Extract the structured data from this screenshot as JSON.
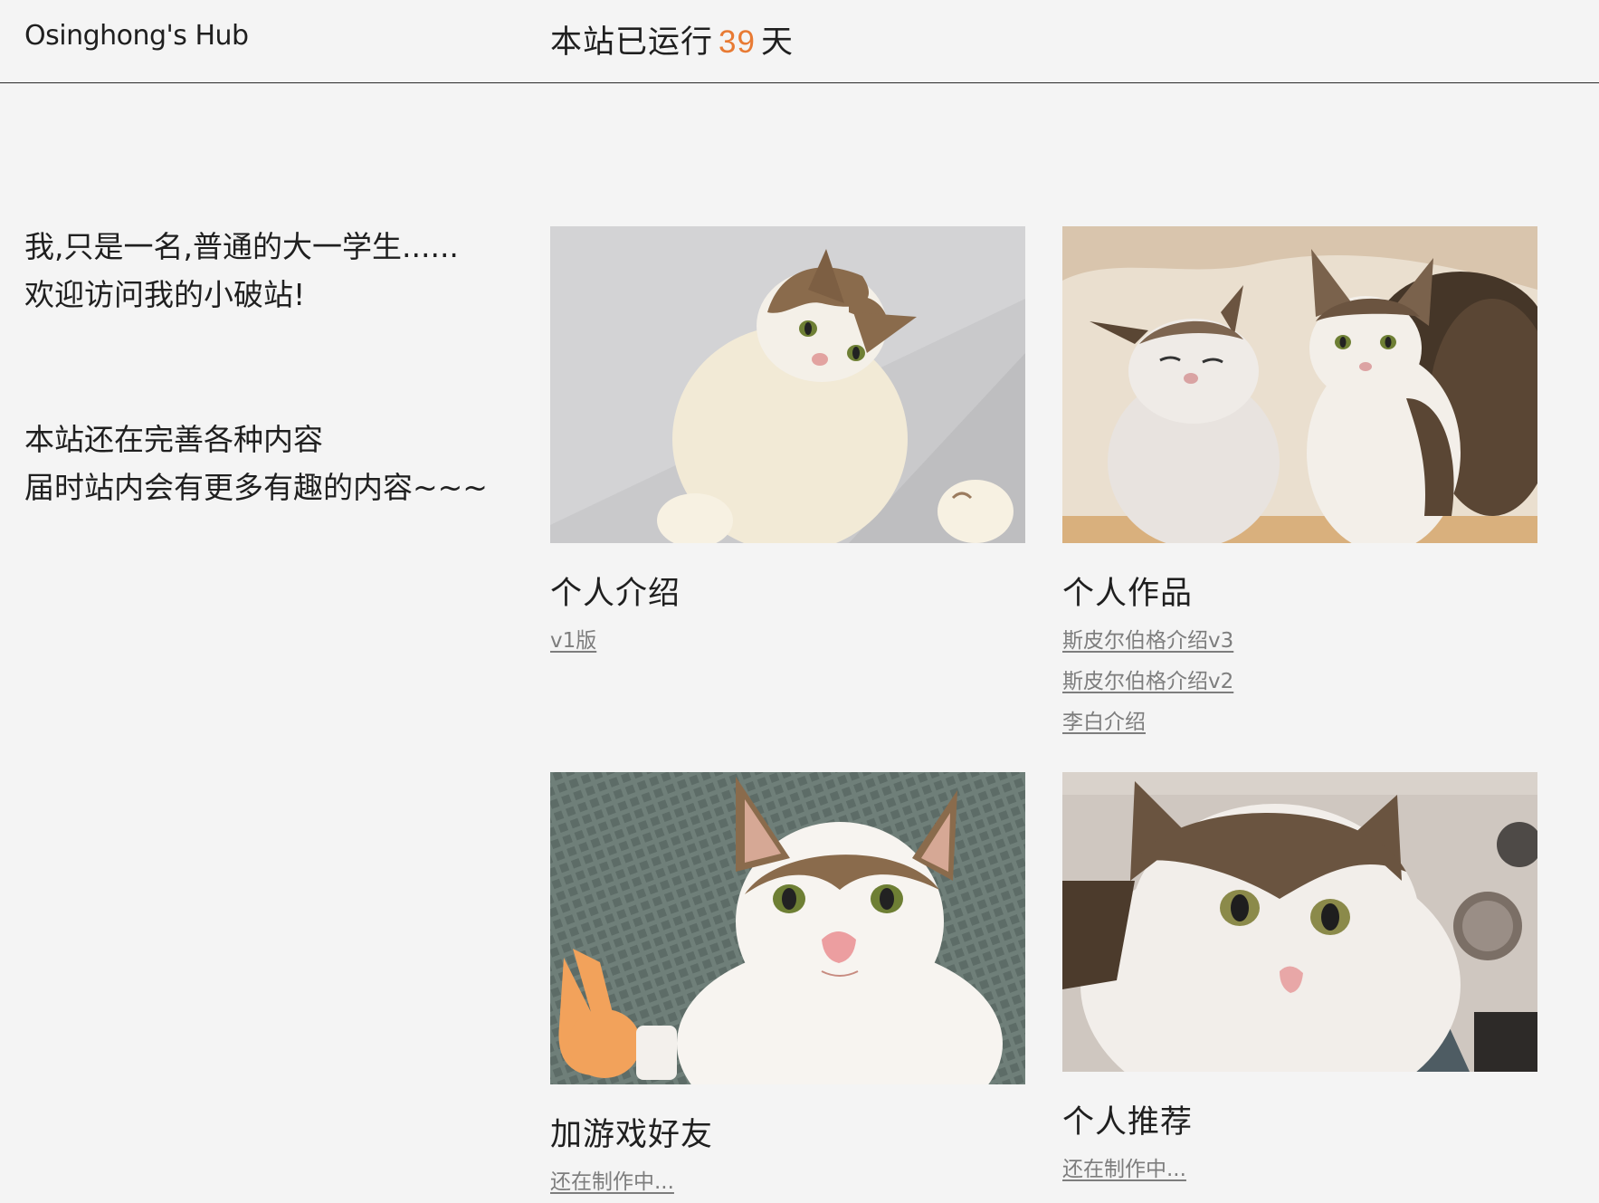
{
  "header": {
    "site_title": "Osinghong's Hub",
    "uptime_prefix": "本站已运行",
    "uptime_days": "39",
    "uptime_suffix": "天"
  },
  "intro": {
    "line1": "我,只是一名,普通的大一学生......",
    "line2": "欢迎访问我的小破站!",
    "line3": "本站还在完善各种内容",
    "line4": "届时站内会有更多有趣的内容~~~"
  },
  "cards": [
    {
      "title": "个人介绍",
      "links": [
        "v1版"
      ]
    },
    {
      "title": "个人作品",
      "links": [
        "斯皮尔伯格介绍v3",
        "斯皮尔伯格介绍v2",
        "李白介绍"
      ]
    },
    {
      "title": "加游戏好友",
      "links": [
        "还在制作中..."
      ]
    },
    {
      "title": "个人推荐",
      "links": [
        "还在制作中..."
      ]
    }
  ],
  "colors": {
    "background": "#f4f4f4",
    "text": "#1f1f1f",
    "accent": "#e87a33",
    "link": "#7d7d7d"
  }
}
